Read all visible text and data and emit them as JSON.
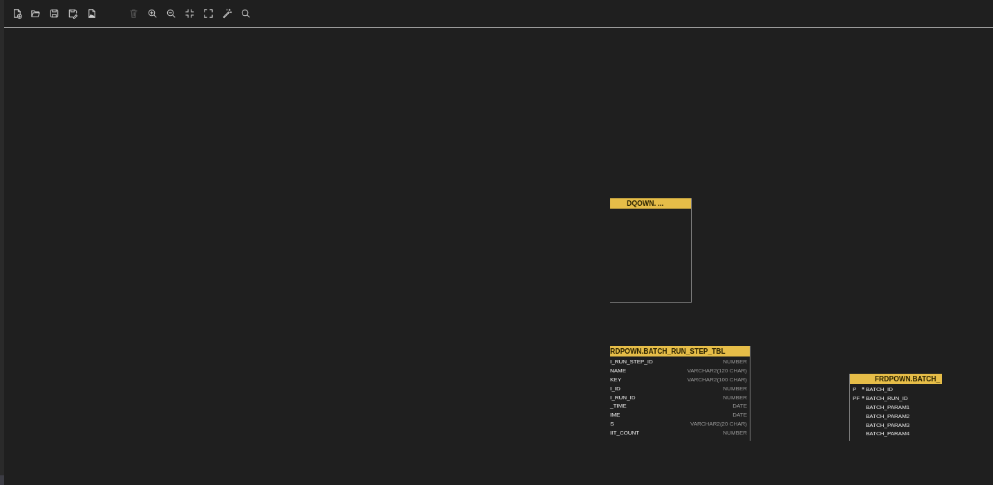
{
  "toolbar": [
    {
      "kind": "new",
      "disabled": false
    },
    {
      "kind": "open",
      "disabled": false
    },
    {
      "kind": "save",
      "disabled": false
    },
    {
      "kind": "save-as",
      "disabled": false
    },
    {
      "kind": "export-image",
      "disabled": false
    },
    {
      "kind": "delete",
      "disabled": true
    },
    {
      "kind": "zoom-in",
      "disabled": false
    },
    {
      "kind": "zoom-out",
      "disabled": false
    },
    {
      "kind": "fit",
      "disabled": false
    },
    {
      "kind": "fullscreen",
      "disabled": false
    },
    {
      "kind": "auto-layout",
      "disabled": false
    },
    {
      "kind": "search",
      "disabled": false
    }
  ],
  "tables": [
    {
      "title": "DQOWN. ..."
    },
    {
      "title": "RDPOWN.BATCH_RUN_STEP_TBL",
      "columns": [
        {
          "name": "I_RUN_STEP_ID",
          "type": "NUMBER"
        },
        {
          "name": "NAME",
          "type": "VARCHAR2(120 CHAR)"
        },
        {
          "name": "KEY",
          "type": "VARCHAR2(100 CHAR)"
        },
        {
          "name": "I_ID",
          "type": "NUMBER"
        },
        {
          "name": "I_RUN_ID",
          "type": "NUMBER"
        },
        {
          "name": "_TIME",
          "type": "DATE"
        },
        {
          "name": "IME",
          "type": "DATE"
        },
        {
          "name": "S",
          "type": "VARCHAR2(20 CHAR)"
        },
        {
          "name": "IIT_COUNT",
          "type": "NUMBER"
        }
      ]
    },
    {
      "title": "FRDPOWN.BATCH_",
      "columns": [
        {
          "key": "P",
          "mandatory": true,
          "name": "BATCH_ID"
        },
        {
          "key": "PF",
          "mandatory": true,
          "name": "BATCH_RUN_ID"
        },
        {
          "mandatory": false,
          "name": "BATCH_PARAM1"
        },
        {
          "mandatory": false,
          "name": "BATCH_PARAM2"
        },
        {
          "mandatory": false,
          "name": "BATCH_PARAM3"
        },
        {
          "mandatory": false,
          "name": "BATCH_PARAM4"
        }
      ]
    }
  ]
}
